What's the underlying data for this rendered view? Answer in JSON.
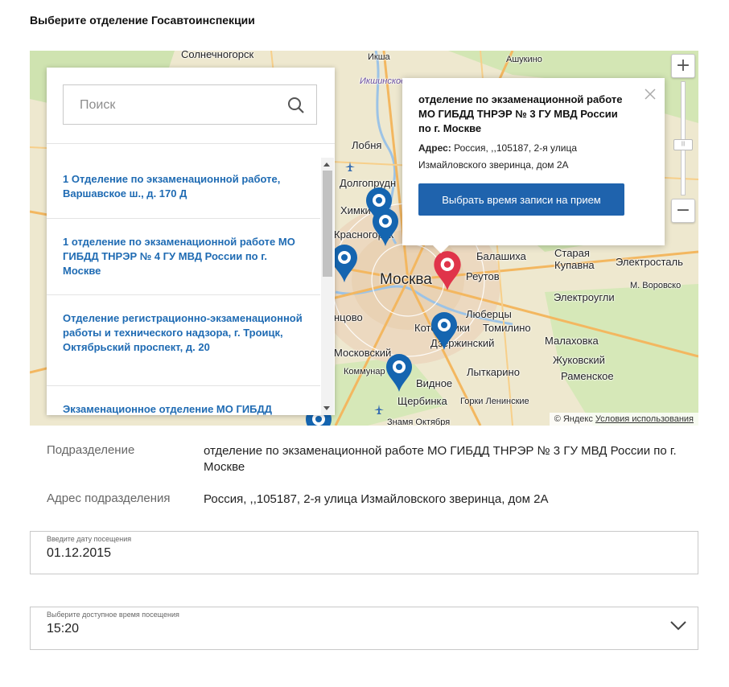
{
  "page": {
    "title": "Выберите отделение Госавтоинспекции"
  },
  "map": {
    "labels": {
      "solnechnogorsk": "Солнечногорск",
      "iksha": "Икша",
      "ashukino": "Ашукино",
      "lobnya": "Лобня",
      "dolgoprudny": "Долгопрудн",
      "khimki": "Химки",
      "krasnogorsk": "Красногорск",
      "moskva": "Москва",
      "reutov": "Реутов",
      "balashikha": "Балашиха",
      "staraya_kupavna": "Старая\nКупавна",
      "elektrostal": "Электросталь",
      "elektrougli": "Электроугли",
      "lyubertsy": "Люберцы",
      "tomilino": "Томилино",
      "malakhovka": "Малаховка",
      "zhukovsky": "Жуковский",
      "dzerzhinsky": "Дзержинский",
      "lytkarino": "Лыткарино",
      "ramenskoye": "Раменское",
      "vidnoye": "Видное",
      "shcherbinka": "Щербинка",
      "gorki_leninskie": "Горки Ленинские",
      "kotelniki": "Котельники",
      "moskovsky": "Московский",
      "kommunar": "Коммунар",
      "vnukovo": "нцово",
      "fryazevo": "М. Воровско",
      "zlatogor": "Знамя Октября",
      "ikshinskoe": "Икшинское"
    },
    "copyright": "© Яндекс",
    "terms": "Условия использования",
    "zoom_in": "+",
    "zoom_out": "−"
  },
  "search": {
    "placeholder": "Поиск"
  },
  "offices": [
    "1 Отделение по экзаменационной работе, Варшавское ш., д. 170 Д",
    "1 отделение по экзаменационной работе МО ГИБДД ТНРЭР № 4 ГУ МВД России по г. Москве",
    "Отделение регистрационно-экзаменационной работы и технического надзора, г. Троицк, Октябрьский проспект, д. 20",
    "Экзаменационное отделение МО ГИБДД"
  ],
  "balloon": {
    "title": "отделение по экзаменационной работе МО ГИБДД ТНРЭР № 3 ГУ МВД России по г. Москве",
    "address_label": "Адрес:",
    "address": "Россия, ,,105187, 2-я улица Измайловского зверинца, дом 2А",
    "button": "Выбрать время записи на прием"
  },
  "details": {
    "division_label": "Подразделение",
    "division_value": "отделение по экзаменационной работе МО ГИБДД ТНРЭР № 3 ГУ МВД России по г. Москве",
    "address_label": "Адрес подразделения",
    "address_value": "Россия, ,,105187, 2-я улица Измайловского зверинца, дом 2А"
  },
  "date_field": {
    "caption": "Введите дату посещения",
    "value": "01.12.2015"
  },
  "time_field": {
    "caption": "Выберите доступное время посещения",
    "value": "15:20"
  },
  "colors": {
    "accent": "#1f63ad",
    "link": "#1f6bb3",
    "pin_blue": "#1565b0",
    "pin_red": "#e0344a"
  }
}
